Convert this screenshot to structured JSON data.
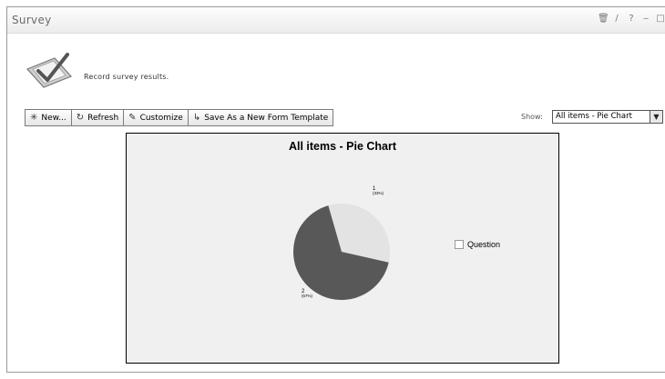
{
  "window": {
    "title": "Survey",
    "controls": [
      "delete-icon",
      "edit-icon",
      "help-icon",
      "minimize-icon",
      "maximize-icon"
    ]
  },
  "intro": {
    "icon": "survey-checkmark-icon",
    "text": "Record survey results."
  },
  "toolbar": {
    "new_label": "New...",
    "refresh_label": "Refresh",
    "customize_label": "Customize",
    "save_template_label": "Save As a New Form Template"
  },
  "view_selector": {
    "label": "Show:",
    "value": "All items - Pie Chart"
  },
  "chart_data": {
    "type": "pie",
    "title": "All items - Pie Chart",
    "slices": [
      {
        "label": "1",
        "value": 33,
        "percent_label": "(33%)",
        "color": "#e3e3e3"
      },
      {
        "label": "2",
        "value": 67,
        "percent_label": "(67%)",
        "color": "#585858"
      }
    ],
    "legend": [
      {
        "label": "Question",
        "color": "#ffffff"
      }
    ],
    "legend_position": "right"
  },
  "colors": {
    "chart_background": "#f0f0f0"
  }
}
